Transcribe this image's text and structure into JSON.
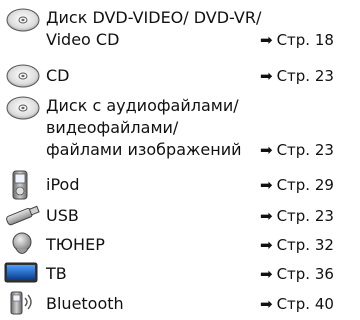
{
  "items": [
    {
      "icon": "disc-icon",
      "lines": [
        "Диск DVD-VIDEO/ DVD-VR/",
        "Video CD"
      ],
      "arrow": "➡",
      "page_ref": "Стр. 18"
    },
    {
      "icon": "disc-icon",
      "lines": [
        "CD"
      ],
      "arrow": "➡",
      "page_ref": "Стр. 23"
    },
    {
      "icon": "disc-icon",
      "lines": [
        "Диск с аудиофайлами/",
        "видеофайлами/",
        "файлами изображений"
      ],
      "arrow": "➡",
      "page_ref": "Стр. 23"
    },
    {
      "icon": "ipod-icon",
      "lines": [
        "iPod"
      ],
      "arrow": "➡",
      "page_ref": "Стр. 29"
    },
    {
      "icon": "usb-stick-icon",
      "lines": [
        "USB"
      ],
      "arrow": "➡",
      "page_ref": "Стр. 23"
    },
    {
      "icon": "radio-tuner-icon",
      "lines": [
        "ТЮНЕР"
      ],
      "arrow": "➡",
      "page_ref": "Стр. 32"
    },
    {
      "icon": "tv-icon",
      "lines": [
        "TB"
      ],
      "arrow": "➡",
      "page_ref": "Стр. 36"
    },
    {
      "icon": "bluetooth-phone-icon",
      "lines": [
        "Bluetooth"
      ],
      "arrow": "➡",
      "page_ref": "Стр. 40"
    }
  ]
}
